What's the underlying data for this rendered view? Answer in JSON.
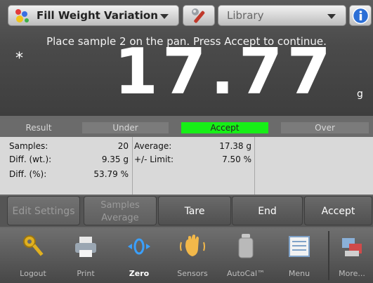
{
  "header": {
    "app_title": "Fill Weight Variation",
    "library_label": "Library",
    "instruction": "Place sample  2 on the pan. Press Accept to continue.",
    "stability_mark": "*",
    "weight_value": "17.77",
    "weight_unit": "g"
  },
  "status": {
    "result": "Result",
    "under": "Under",
    "accept": "Accept",
    "over": "Over",
    "active": "Accept",
    "accept_color": "#17ef17"
  },
  "stats": {
    "samples_label": "Samples:",
    "samples_value": "20",
    "average_label": "Average:",
    "average_value": "17.38 g",
    "diff_wt_label": "Diff. (wt.):",
    "diff_wt_value": "9.35 g",
    "limit_label": "+/- Limit:",
    "limit_value": "7.50 %",
    "diff_pct_label": "Diff. (%):",
    "diff_pct_value": "53.79 %"
  },
  "actions": {
    "edit_settings": "Edit Settings",
    "samples_average_line1": "Samples",
    "samples_average_line2": "Average",
    "tare": "Tare",
    "end": "End",
    "accept": "Accept"
  },
  "nav": {
    "items": [
      {
        "label": "Logout",
        "icon": "key-icon"
      },
      {
        "label": "Print",
        "icon": "printer-icon"
      },
      {
        "label": "Zero",
        "icon": "zero-icon"
      },
      {
        "label": "Sensors",
        "icon": "hand-sensor-icon"
      },
      {
        "label": "AutoCal™",
        "icon": "calibration-weight-icon"
      },
      {
        "label": "Menu",
        "icon": "menu-icon"
      },
      {
        "label": "More...",
        "icon": "more-icon"
      }
    ],
    "active": "Zero"
  }
}
